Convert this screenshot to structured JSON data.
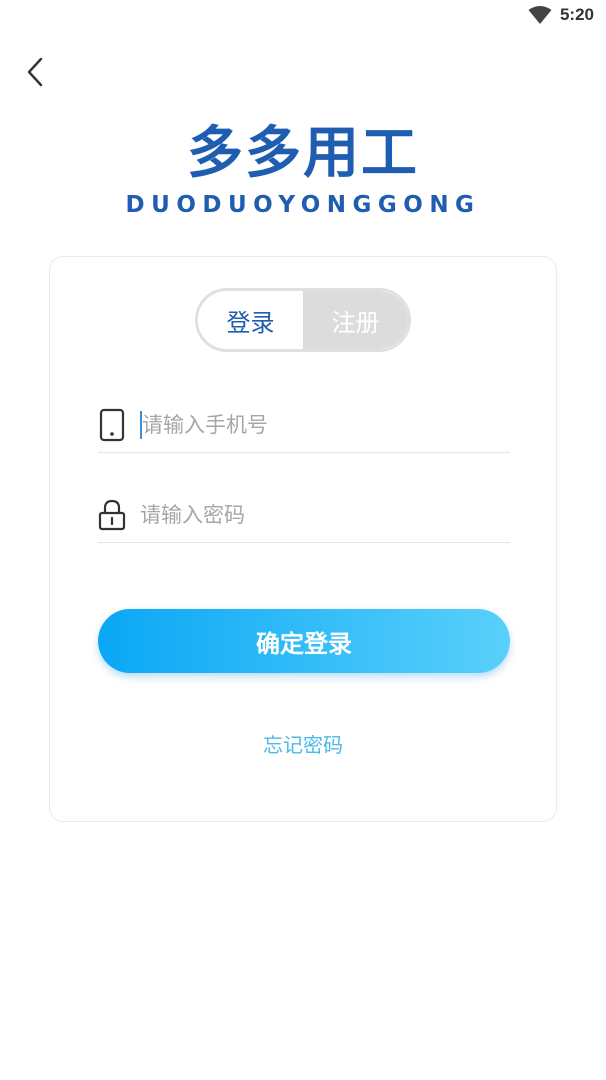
{
  "status_bar": {
    "time": "5:20",
    "wifi_icon": "wifi-icon"
  },
  "header": {
    "back_icon": "chevron-left-icon"
  },
  "logo": {
    "title_cn": "多多用工",
    "title_en": "DUODUOYONGGONG",
    "color": "#1f5db0"
  },
  "auth_tabs": {
    "login_label": "登录",
    "register_label": "注册",
    "active": "login"
  },
  "form": {
    "phone": {
      "placeholder": "请输入手机号",
      "value": "",
      "icon": "phone-icon"
    },
    "password": {
      "placeholder": "请输入密码",
      "value": "",
      "icon": "lock-icon"
    },
    "submit_label": "确定登录",
    "forgot_label": "忘记密码"
  },
  "colors": {
    "accent_start": "#0aa7f5",
    "accent_end": "#5ad0fb",
    "link": "#4bb9ea"
  }
}
